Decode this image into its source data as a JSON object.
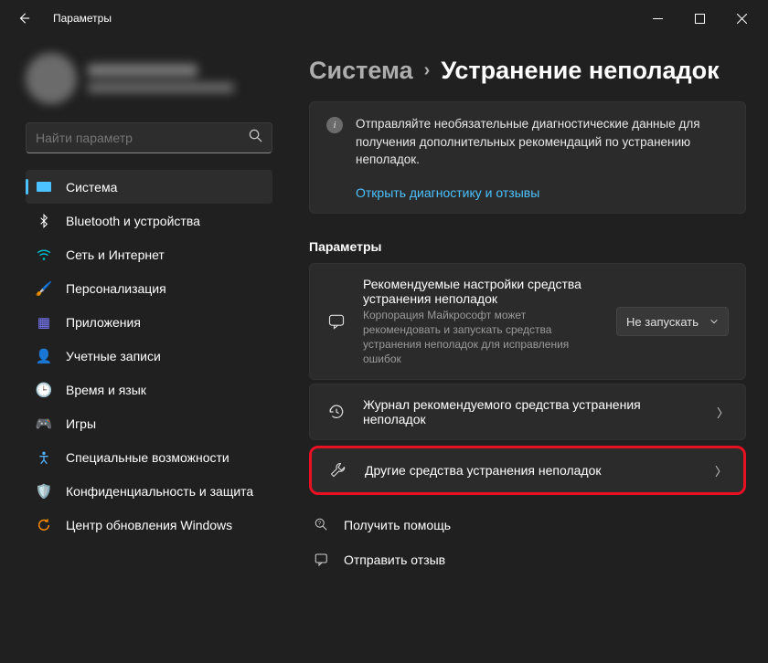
{
  "window": {
    "title": "Параметры"
  },
  "profile": {
    "name": "",
    "email": ""
  },
  "search": {
    "placeholder": "Найти параметр"
  },
  "sidebar": {
    "items": [
      {
        "label": "Система",
        "icon": "🖥️",
        "color": "#4cc2ff",
        "active": true
      },
      {
        "label": "Bluetooth и устройства",
        "icon": "bt",
        "color": "#0078d4"
      },
      {
        "label": "Сеть и Интернет",
        "icon": "wifi",
        "color": "#00b7c3"
      },
      {
        "label": "Персонализация",
        "icon": "🖌️",
        "color": "#e8a33d"
      },
      {
        "label": "Приложения",
        "icon": "▦",
        "color": "#7a7aff"
      },
      {
        "label": "Учетные записи",
        "icon": "👤",
        "color": "#2ac98f"
      },
      {
        "label": "Время и язык",
        "icon": "🕒",
        "color": "#5ea9ff"
      },
      {
        "label": "Игры",
        "icon": "🎮",
        "color": "#888"
      },
      {
        "label": "Специальные возможности",
        "icon": "acc",
        "color": "#57b1ff"
      },
      {
        "label": "Конфиденциальность и защита",
        "icon": "🛡️",
        "color": "#7ca0c9"
      },
      {
        "label": "Центр обновления Windows",
        "icon": "⟳",
        "color": "#ff8c00"
      }
    ]
  },
  "breadcrumb": {
    "parent": "Система",
    "sep": "›",
    "current": "Устранение неполадок"
  },
  "info": {
    "text": "Отправляйте необязательные диагностические данные для получения дополнительных рекомендаций по устранению неполадок.",
    "link": "Открыть диагностику и отзывы"
  },
  "section_label": "Параметры",
  "cards": {
    "recommended": {
      "title": "Рекомендуемые настройки средства устранения неполадок",
      "sub": "Корпорация Майкрософт может рекомендовать и запускать средства устранения неполадок для исправления ошибок",
      "dropdown": "Не запускать"
    },
    "history": {
      "title": "Журнал рекомендуемого средства устранения неполадок"
    },
    "other": {
      "title": "Другие средства устранения неполадок"
    }
  },
  "footer": {
    "help": "Получить помощь",
    "feedback": "Отправить отзыв"
  }
}
